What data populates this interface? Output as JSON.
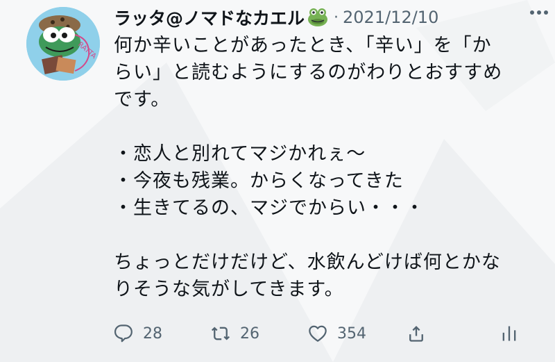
{
  "tweet": {
    "display_name": "ラッタ@ノマドなカエル",
    "separator": "·",
    "date": "2021/12/10",
    "text": "何か辛いことがあったとき、「辛い」を「か\nらい」と読むようにするのがわりとおすすめ\nです。\n\n・恋人と別れてマジかれぇ～\n・今夜も残業。からくなってきた\n・生きてるの、マジでからい・・・\n\nちょっとだけだけど、水飲んどけば何とかな\nりそうな気がしてきます。",
    "name_emoji": "frog-face-emoji",
    "avatar_text": "RATTA"
  },
  "actions": {
    "reply_count": "28",
    "retweet_count": "26",
    "like_count": "354"
  },
  "icons": {
    "more": "more-horizontal-icon",
    "reply": "reply-icon",
    "retweet": "retweet-icon",
    "like": "heart-icon",
    "share": "share-icon",
    "stats": "analytics-icon"
  },
  "colors": {
    "text": "#0f1419",
    "secondary": "#536471",
    "background": "#f7f8f9"
  }
}
